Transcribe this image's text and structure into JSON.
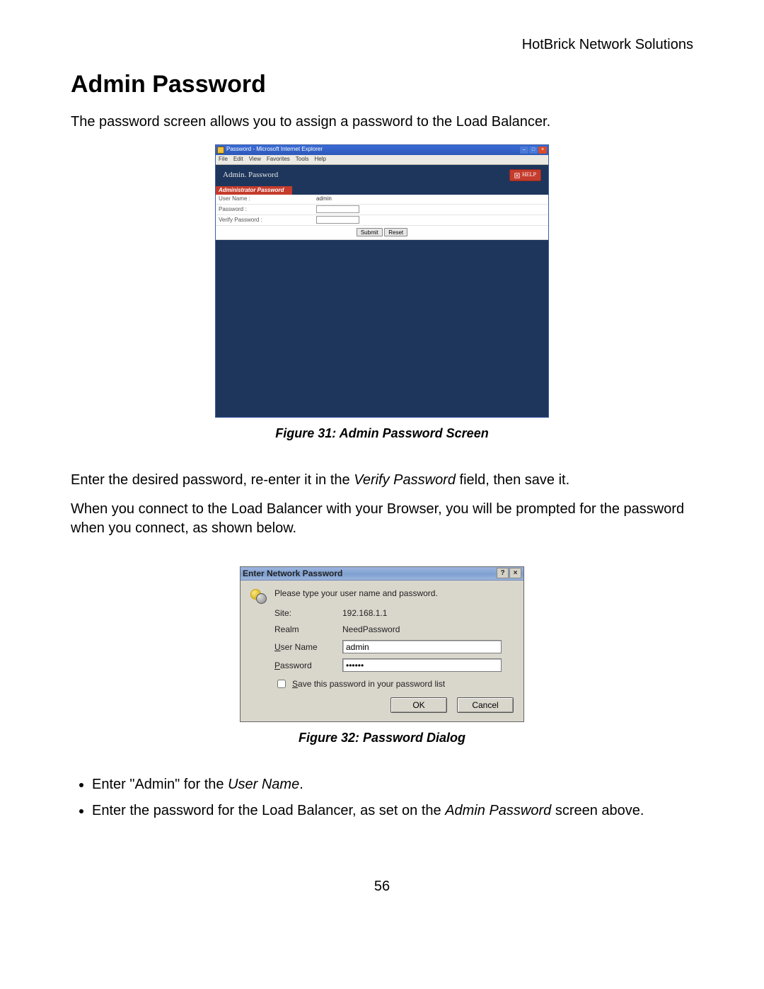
{
  "header_company": "HotBrick Network Solutions",
  "title": "Admin Password",
  "intro": "The password screen allows you to assign a password to the Load Balancer.",
  "fig31": {
    "caption": "Figure 31: Admin Password Screen",
    "window_title": "Password - Microsoft Internet Explorer",
    "menu": [
      "File",
      "Edit",
      "View",
      "Favorites",
      "Tools",
      "Help"
    ],
    "panel_title": "Admin. Password",
    "help_label": "HELP",
    "section_label": "Administrator Password",
    "rows": {
      "user_name_label": "User Name :",
      "user_name_value": "admin",
      "password_label": "Password :",
      "verify_label": "Verify Password :"
    },
    "buttons": {
      "submit": "Submit",
      "reset": "Reset"
    }
  },
  "mid_text_1": "Enter the desired password, re-enter it in the ",
  "mid_text_1_em": "Verify Password",
  "mid_text_1_tail": " field, then save it.",
  "mid_text_2": "When you connect to the Load Balancer with your Browser, you will be prompted for the password when you connect, as shown below.",
  "fig32": {
    "caption": "Figure 32: Password Dialog",
    "title": "Enter Network Password",
    "prompt": "Please type your user name and password.",
    "site_label": "Site:",
    "site_value": "192.168.1.1",
    "realm_label": "Realm",
    "realm_value": "NeedPassword",
    "user_label_pre": "U",
    "user_label_rest": "ser Name",
    "user_value": "admin",
    "pass_label_pre": "P",
    "pass_label_rest": "assword",
    "pass_value": "••••••",
    "save_label_pre": "S",
    "save_label_rest": "ave this password in your password list",
    "ok": "OK",
    "cancel": "Cancel"
  },
  "bullets": {
    "b1_pre": "Enter \"Admin\" for the ",
    "b1_em": "User Name",
    "b1_post": ".",
    "b2_pre": "Enter the password for the Load Balancer, as set on the ",
    "b2_em": "Admin Password",
    "b2_post": " screen above."
  },
  "page_number": "56"
}
